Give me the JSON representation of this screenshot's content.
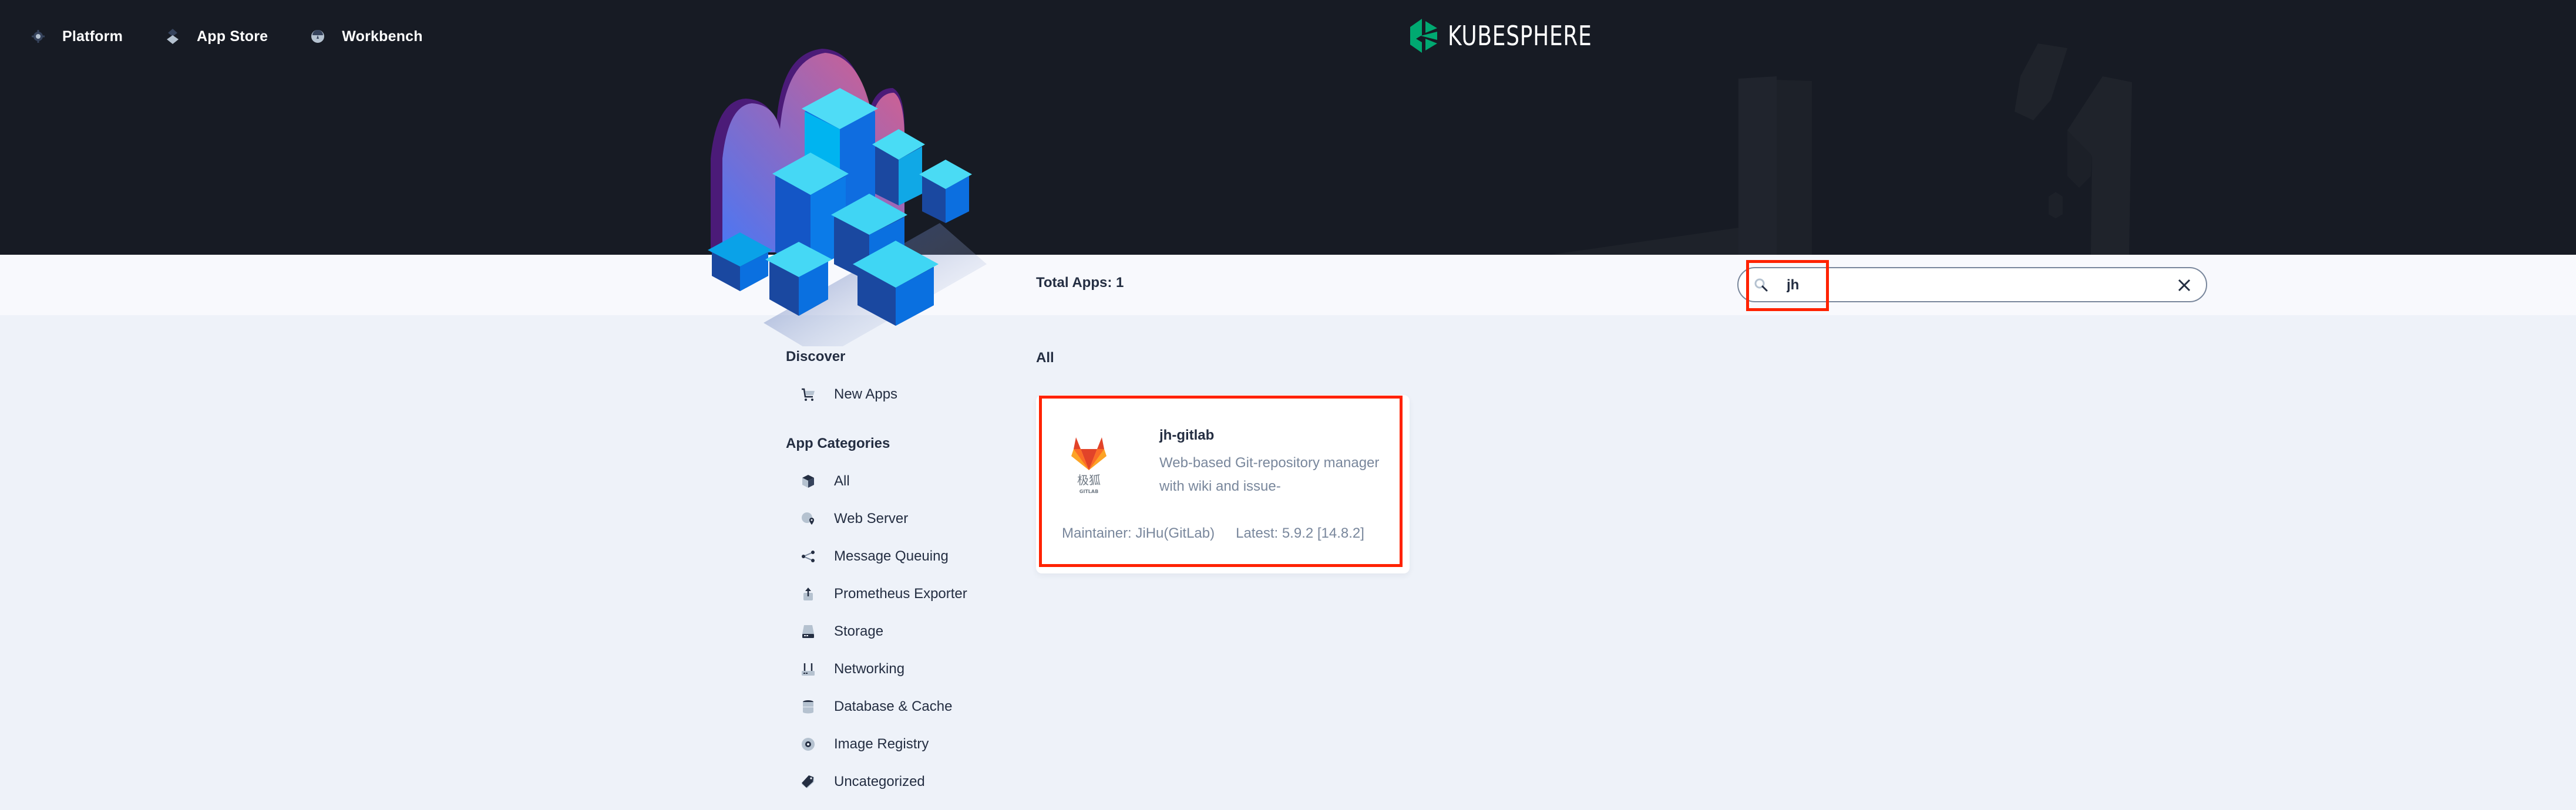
{
  "nav": {
    "items": [
      {
        "label": "Platform",
        "icon": "gear-icon"
      },
      {
        "label": "App Store",
        "icon": "layers-icon"
      },
      {
        "label": "Workbench",
        "icon": "dashboard-icon"
      }
    ]
  },
  "brand": {
    "name": "KUBESPHERE",
    "color": "#00a971"
  },
  "toolbar": {
    "total_label": "Total Apps: 1",
    "search": {
      "value": "jh",
      "placeholder": ""
    }
  },
  "sidebar": {
    "discover_title": "Discover",
    "discover_items": [
      {
        "label": "New Apps",
        "icon": "cart-icon"
      }
    ],
    "categories_title": "App Categories",
    "categories": [
      {
        "label": "All",
        "icon": "cube-icon"
      },
      {
        "label": "Web Server",
        "icon": "globe-pin-icon"
      },
      {
        "label": "Message Queuing",
        "icon": "share-nodes-icon"
      },
      {
        "label": "Prometheus Exporter",
        "icon": "export-icon"
      },
      {
        "label": "Storage",
        "icon": "hard-drive-icon"
      },
      {
        "label": "Networking",
        "icon": "router-icon"
      },
      {
        "label": "Database & Cache",
        "icon": "database-icon"
      },
      {
        "label": "Image Registry",
        "icon": "disc-icon"
      },
      {
        "label": "Uncategorized",
        "icon": "tag-icon"
      }
    ]
  },
  "content": {
    "title": "All",
    "apps": [
      {
        "name": "jh-gitlab",
        "description": "Web-based Git-repository manager with wiki and issue-",
        "maintainer": "Maintainer: JiHu(GitLab)",
        "latest": "Latest: 5.9.2 [14.8.2]",
        "logo_text_cn": "极狐",
        "logo_text_en": "GITLAB"
      }
    ]
  },
  "colors": {
    "header_bg": "#171b24",
    "toolbar_bg": "#f8f9fd",
    "body_bg": "#eef2f9",
    "highlight": "#ff2200",
    "text_primary": "#242e42",
    "text_secondary": "#79879c"
  }
}
